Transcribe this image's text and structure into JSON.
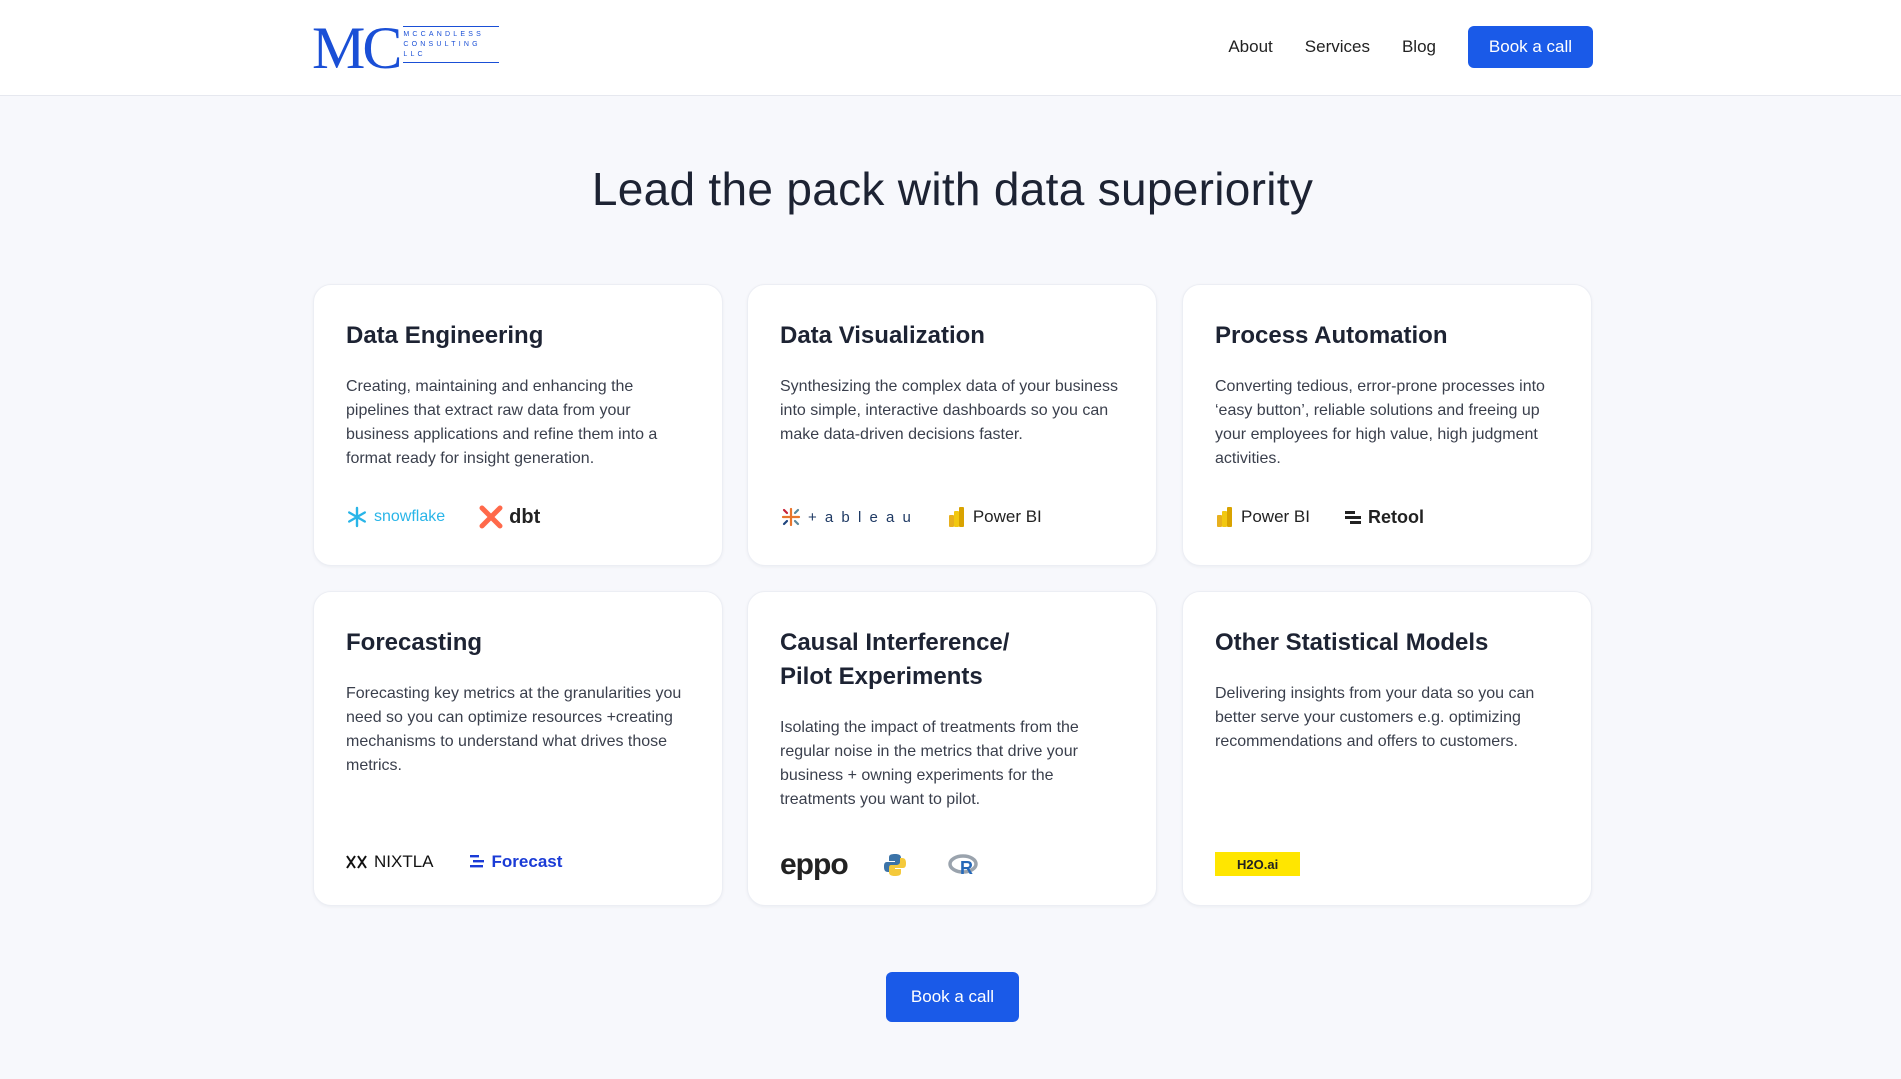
{
  "header": {
    "logo_letters": "MC",
    "logo_line1": "MCCANDLESS",
    "logo_line2": "CONSULTING",
    "logo_line3": "LLC",
    "nav": [
      "About",
      "Services",
      "Blog"
    ],
    "cta_label": "Book a call"
  },
  "hero": {
    "title": "Lead the pack with data superiority"
  },
  "cards": [
    {
      "title": "Data Engineering",
      "body": "Creating, maintaining and enhancing the pipelines that extract raw data from your business applications and refine them into a format ready for insight generation.",
      "logos": [
        "snowflake",
        "dbt"
      ]
    },
    {
      "title": "Data Visualization",
      "body": "Synthesizing the complex data of your business into simple, interactive dashboards so you can make data-driven decisions faster.",
      "logos": [
        "+ a b l e a u",
        "Power BI"
      ]
    },
    {
      "title": "Process Automation",
      "body": "Converting tedious, error-prone processes into ‘easy button’, reliable solutions and freeing up your employees for high value, high judgment activities.",
      "logos": [
        "Power BI",
        "Retool"
      ]
    },
    {
      "title_line1": "Forecasting",
      "body": "Forecasting key metrics at the granularities you need so you can optimize resources +creating mechanisms to understand what drives those metrics.",
      "logos": [
        "NIXTLA",
        "Forecast"
      ]
    },
    {
      "title_line1": "Causal Interference/",
      "title_line2": "Pilot Experiments",
      "body": "Isolating the impact of treatments from the regular noise in the metrics that drive your business + owning experiments for the treatments you want to pilot.",
      "logos": [
        "eppo"
      ]
    },
    {
      "title_line1": "Other Statistical Models",
      "body": "Delivering insights from your data so you can better serve your customers e.g. optimizing recommendations and offers to customers.",
      "logos": [
        "H2O.ai"
      ]
    }
  ],
  "footer_cta": "Book a call",
  "colors": {
    "accent": "#1a5ae8",
    "background": "#f7f8fc"
  }
}
